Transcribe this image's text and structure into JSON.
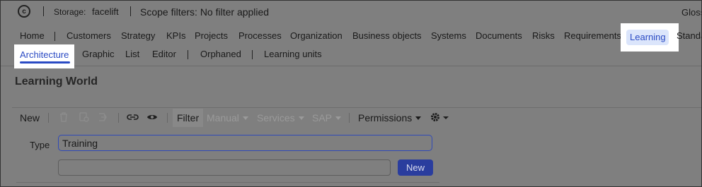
{
  "topbar": {
    "storage_label": "Storage:",
    "storage_value": "facelift",
    "scope_filters": "Scope filters: No filter applied",
    "gloss_truncated": "Gloss"
  },
  "nav": {
    "main_items": [
      {
        "label": "Home"
      },
      {
        "label": "Customers"
      },
      {
        "label": "Strategy"
      },
      {
        "label": "KPIs"
      },
      {
        "label": "Projects"
      },
      {
        "label": "Processes"
      },
      {
        "label": "Organization"
      },
      {
        "label": "Business objects"
      },
      {
        "label": "Systems"
      },
      {
        "label": "Documents"
      },
      {
        "label": "Risks"
      },
      {
        "label": "Requirements"
      },
      {
        "label": "Learning",
        "active": true
      },
      {
        "label": "Standa"
      }
    ],
    "sub_items": [
      {
        "label": "Architecture",
        "active": true
      },
      {
        "label": "Graphic"
      },
      {
        "label": "List"
      },
      {
        "label": "Editor"
      },
      {
        "label": "Orphaned"
      },
      {
        "label": "Learning units"
      }
    ]
  },
  "page": {
    "title": "Learning World"
  },
  "toolbar": {
    "new_label": "New",
    "filter_label": "Filter",
    "manual_label": "Manual",
    "services_label": "Services",
    "sap_label": "SAP",
    "permissions_label": "Permissions",
    "icons": [
      "trash-icon",
      "copy-icon",
      "move-icon",
      "link-icon",
      "eye-icon",
      "gear-icon"
    ]
  },
  "form": {
    "type_label": "Type",
    "type_value": "Training",
    "new_input_value": "",
    "new_button_label": "New"
  },
  "colors": {
    "accent": "#2b4bc4",
    "active_pill": "#dbe5fb",
    "button_bg": "#2a3d9e",
    "overlay_bg": "#7f7f7f"
  }
}
